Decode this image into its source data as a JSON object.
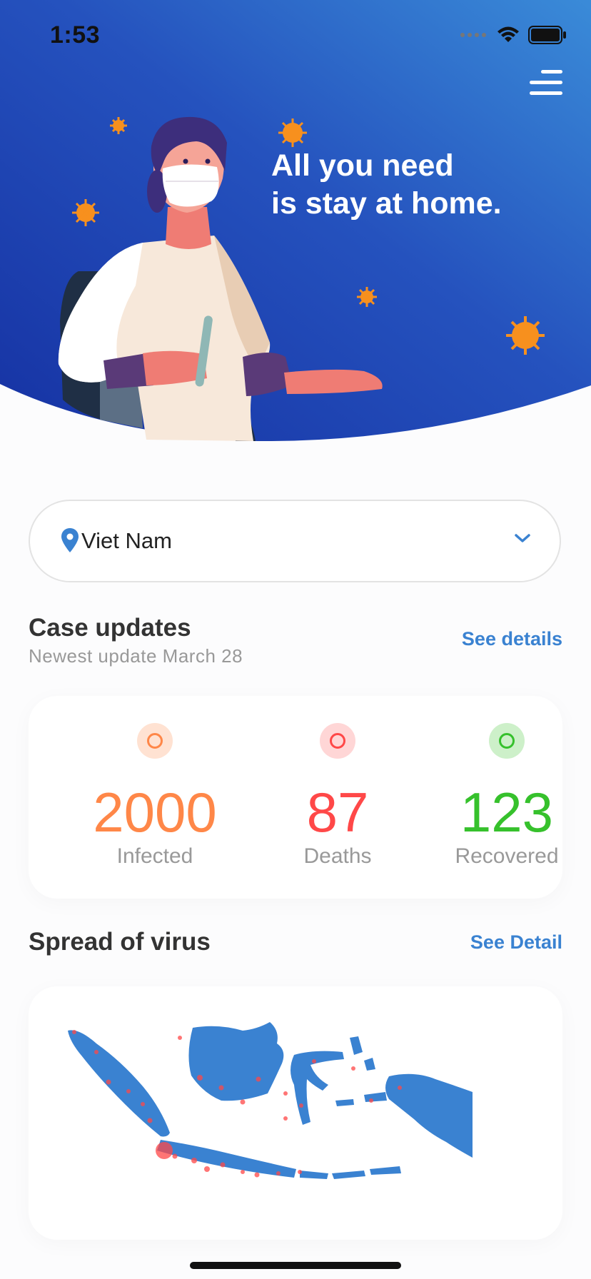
{
  "status_bar": {
    "time": "1:53"
  },
  "hero": {
    "headline_line1": "All you need",
    "headline_line2": "is stay at home."
  },
  "country_select": {
    "value": "Viet Nam"
  },
  "case_updates": {
    "title": "Case updates",
    "subtitle": "Newest update March 28",
    "link": "See details",
    "stats": [
      {
        "value": "2000",
        "label": "Infected",
        "color": "#ff8748",
        "ring_bg": "#ffe2d2"
      },
      {
        "value": "87",
        "label": "Deaths",
        "color": "#ff4848",
        "ring_bg": "#ffd6d6"
      },
      {
        "value": "123",
        "label": "Recovered",
        "color": "#36c12c",
        "ring_bg": "#cdf0c9"
      }
    ]
  },
  "spread": {
    "title": "Spread of virus",
    "link": "See Detail"
  },
  "colors": {
    "accent": "#3a82d1",
    "hero_start": "#1a38a9",
    "hero_end": "#3a8bd6",
    "map_fill": "#3a82d1",
    "hotspot": "#ff4848"
  }
}
